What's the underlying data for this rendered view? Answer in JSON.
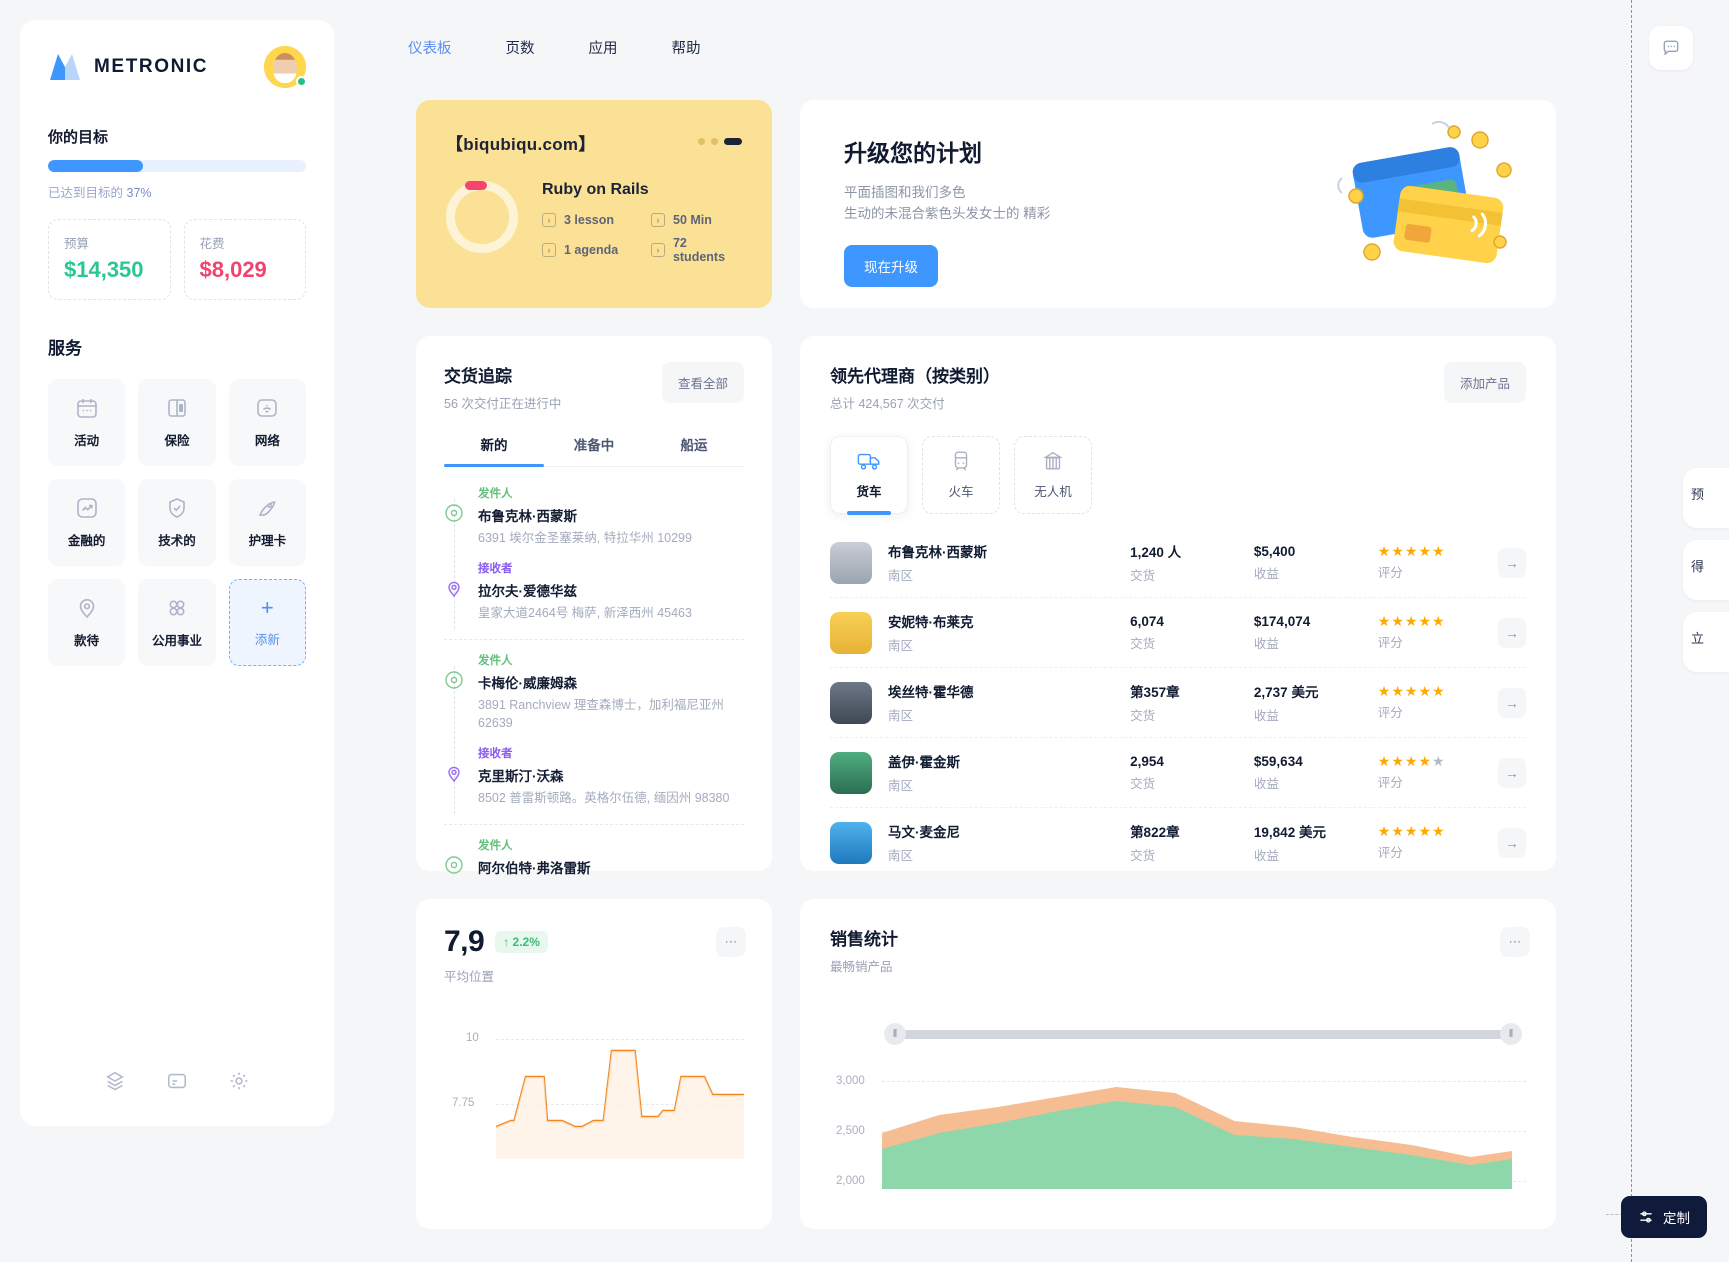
{
  "brand": {
    "name": "METRONIC"
  },
  "sidebar": {
    "goal_title": "你的目标",
    "progress_percent": 37,
    "goal_caption_prefix": "已达到目标的",
    "goal_caption_value": "37%",
    "stats": [
      {
        "label": "预算",
        "value": "$14,350",
        "color": "#2ac78f"
      },
      {
        "label": "花费",
        "value": "$8,029",
        "color": "#f0436f"
      }
    ],
    "services_title": "服务",
    "services": [
      {
        "label": "活动",
        "icon": "calendar-icon"
      },
      {
        "label": "保险",
        "icon": "book-icon"
      },
      {
        "label": "网络",
        "icon": "wifi-icon"
      },
      {
        "label": "金融的",
        "icon": "trending-up-icon"
      },
      {
        "label": "技术的",
        "icon": "shield-check-icon"
      },
      {
        "label": "护理卡",
        "icon": "rocket-icon"
      },
      {
        "label": "款待",
        "icon": "location-pin-icon"
      },
      {
        "label": "公用事业",
        "icon": "grid-dots-icon"
      },
      {
        "label": "添新",
        "icon": "plus-icon",
        "is_add": true
      }
    ],
    "footer_icons": [
      "layers-icon",
      "note-icon",
      "gear-icon"
    ]
  },
  "topnav": {
    "items": [
      {
        "label": "仪表板",
        "active": true
      },
      {
        "label": "页数",
        "active": false
      },
      {
        "label": "应用",
        "active": false
      },
      {
        "label": "帮助",
        "active": false
      }
    ],
    "chat_icon": "chat-bubble-icon"
  },
  "course": {
    "url": "【biqubiqu.com】",
    "title": "Ruby on Rails",
    "meta": [
      "3 lesson",
      "50 Min",
      "1 agenda",
      "72 students"
    ]
  },
  "upgrade": {
    "title": "升级您的计划",
    "sub_line1": "平面插图和我们多色",
    "sub_line2": "生动的未混合紫色头发女士的 精彩",
    "button": "现在升级"
  },
  "tracking": {
    "title": "交货追踪",
    "subtitle": "56 次交付正在进行中",
    "view_all": "查看全部",
    "tabs": [
      {
        "label": "新的",
        "active": true
      },
      {
        "label": "准备中",
        "active": false
      },
      {
        "label": "船运",
        "active": false
      }
    ],
    "label_from": "发件人",
    "label_to": "接收者",
    "shipments": [
      {
        "from_name": "布鲁克林·西蒙斯",
        "from_addr": "6391 埃尔金圣塞莱纳, 特拉华州 10299",
        "to_name": "拉尔夫·爱德华兹",
        "to_addr": "皇家大道2464号 梅萨, 新泽西州 45463"
      },
      {
        "from_name": "卡梅伦·威廉姆森",
        "from_addr": "3891 Ranchview 理查森博士，加利福尼亚州 62639",
        "to_name": "克里斯汀·沃森",
        "to_addr": "8502 普雷斯顿路。英格尔伍德, 缅因州 98380"
      },
      {
        "from_name": "阿尔伯特·弗洛雷斯",
        "from_addr": "",
        "to_name": "",
        "to_addr": ""
      }
    ]
  },
  "agents": {
    "title": "领先代理商（按类别）",
    "subtitle": "总计 424,567 次交付",
    "add_product": "添加产品",
    "categories": [
      {
        "label": "货车",
        "icon": "truck-icon",
        "active": true
      },
      {
        "label": "火车",
        "icon": "train-icon",
        "active": false
      },
      {
        "label": "无人机",
        "icon": "container-icon",
        "active": false
      }
    ],
    "col_delivery": "交货",
    "col_revenue": "收益",
    "col_rating": "评分",
    "rows": [
      {
        "name": "布鲁克林·西蒙斯",
        "region": "南区",
        "delivery": "1,240 人",
        "revenue": "$5,400",
        "stars": 5,
        "avatar": "#cfd3da"
      },
      {
        "name": "安妮特·布莱克",
        "region": "南区",
        "delivery": "6,074",
        "revenue": "$174,074",
        "stars": 5,
        "avatar": "#f5c542"
      },
      {
        "name": "埃丝特·霍华德",
        "region": "南区",
        "delivery": "第357章",
        "revenue": "2,737 美元",
        "stars": 5,
        "avatar": "#5b6470"
      },
      {
        "name": "盖伊·霍金斯",
        "region": "南区",
        "delivery": "2,954",
        "revenue": "$59,634",
        "stars": 4,
        "avatar": "#3f9d6d"
      },
      {
        "name": "马文·麦金尼",
        "region": "南区",
        "delivery": "第822章",
        "revenue": "19,842 美元",
        "stars": 5,
        "avatar": "#2f9ae0"
      }
    ],
    "arrow": "→"
  },
  "avg_position": {
    "value": "7,9",
    "delta": "↑ 2.2%",
    "caption": "平均位置",
    "menu_icon": "more-horizontal-icon"
  },
  "sales": {
    "title": "销售统计",
    "subtitle": "最畅销产品",
    "menu_icon": "more-horizontal-icon"
  },
  "footer": {
    "customize": "定制",
    "customize_icon": "sliders-icon"
  },
  "chart_data": [
    {
      "type": "line",
      "title": "平均位置",
      "ylabel": "",
      "xlabel": "",
      "ylim": [
        5.5,
        10
      ],
      "yticks": [
        10,
        7.75
      ],
      "ytick_labels": [
        "10",
        "7.75"
      ],
      "grid": true,
      "series": [
        {
          "name": "position",
          "color": "#f1861f",
          "values": [
            6.2,
            6.3,
            7.4,
            7.4,
            6.3,
            6.2,
            6.3,
            8.0,
            8.0,
            6.6,
            6.5,
            7.4,
            7.4,
            7.0
          ]
        }
      ]
    },
    {
      "type": "area",
      "title": "销售统计",
      "subtitle": "最畅销产品",
      "ylim": [
        2000,
        3000
      ],
      "yticks": [
        3000,
        2500,
        2000
      ],
      "ytick_labels": [
        "3,000",
        "2,500",
        "2,000"
      ],
      "grid": true,
      "series": [
        {
          "name": "series-a",
          "color": "#f5b183",
          "values": [
            2430,
            2520,
            2560,
            2610,
            2660,
            2620,
            2480,
            2450,
            2400,
            2360,
            2300,
            2330
          ]
        },
        {
          "name": "series-b",
          "color": "#7fd1a0",
          "values": [
            2350,
            2430,
            2480,
            2540,
            2590,
            2560,
            2420,
            2400,
            2360,
            2320,
            2270,
            2300
          ]
        }
      ]
    }
  ]
}
